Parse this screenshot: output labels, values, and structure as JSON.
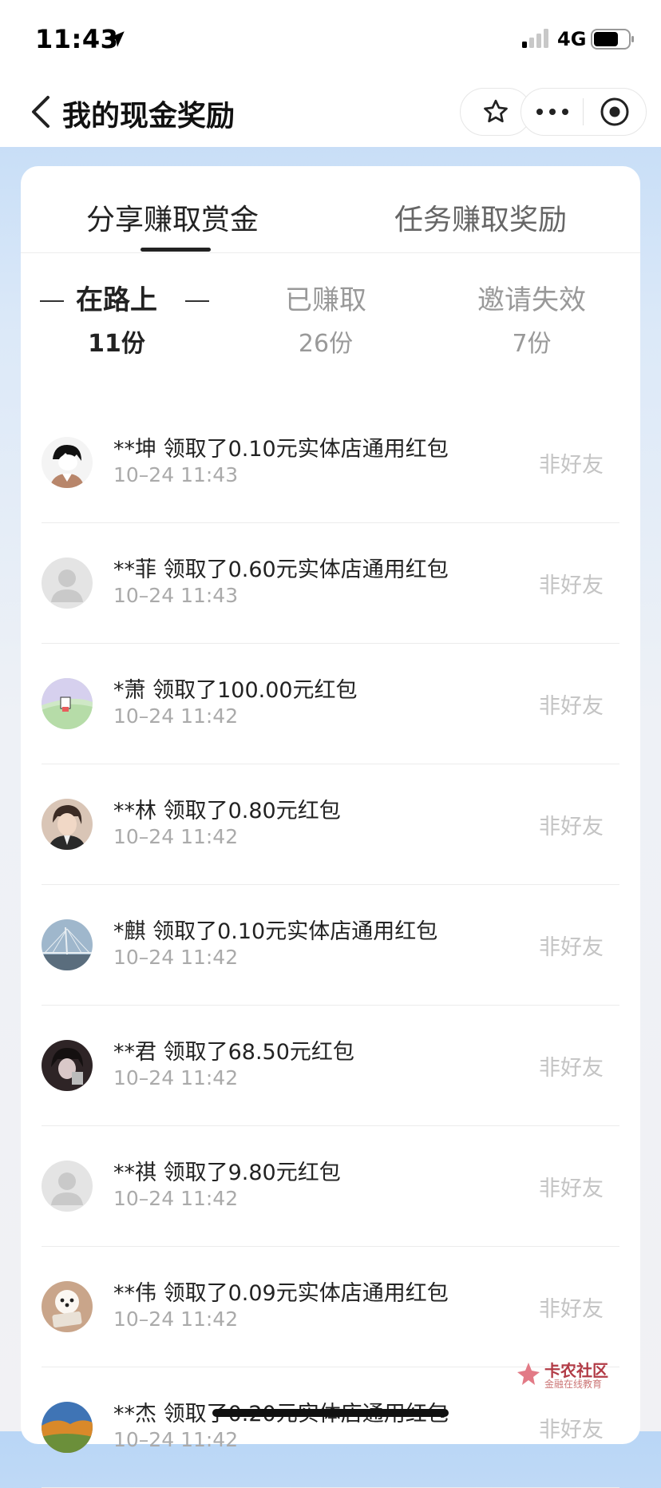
{
  "status_bar": {
    "time": "11:43",
    "network": "4G"
  },
  "nav": {
    "title": "我的现金奖励"
  },
  "tabs": [
    {
      "label": "分享赚取赏金"
    },
    {
      "label": "任务赚取奖励"
    }
  ],
  "subtabs": [
    {
      "label": "在路上",
      "count": "11份"
    },
    {
      "label": "已赚取",
      "count": "26份"
    },
    {
      "label": "邀请失效",
      "count": "7份"
    }
  ],
  "list": [
    {
      "title": "**坤 领取了0.10元实体店通用红包",
      "time": "10–24 11:43",
      "tag": "非好友",
      "avatar": "cartoon-boy"
    },
    {
      "title": "**菲 领取了0.60元实体店通用红包",
      "time": "10–24 11:43",
      "tag": "非好友",
      "avatar": "default-person"
    },
    {
      "title": "*萧 领取了100.00元红包",
      "time": "10–24 11:42",
      "tag": "非好友",
      "avatar": "cartoon-sky"
    },
    {
      "title": "**林 领取了0.80元红包",
      "time": "10–24 11:42",
      "tag": "非好友",
      "avatar": "anime-man"
    },
    {
      "title": "*麒 领取了0.10元实体店通用红包",
      "time": "10–24 11:42",
      "tag": "非好友",
      "avatar": "bridge"
    },
    {
      "title": "**君 领取了68.50元红包",
      "time": "10–24 11:42",
      "tag": "非好友",
      "avatar": "dark-photo"
    },
    {
      "title": "**祺 领取了9.80元红包",
      "time": "10–24 11:42",
      "tag": "非好友",
      "avatar": "default-person"
    },
    {
      "title": "**伟 领取了0.09元实体店通用红包",
      "time": "10–24 11:42",
      "tag": "非好友",
      "avatar": "puppy"
    },
    {
      "title": "**杰 领取了0.20元实体店通用红包",
      "time": "10–24 11:42",
      "tag": "非好友",
      "avatar": "autumn-landscape"
    }
  ],
  "watermark": {
    "main": "卡农社区",
    "sub": "金融在线教育"
  },
  "colors": {
    "accent": "#222222",
    "muted": "#999999",
    "tag": "#c4c4c4",
    "bg_top": "#b9d6f6"
  }
}
